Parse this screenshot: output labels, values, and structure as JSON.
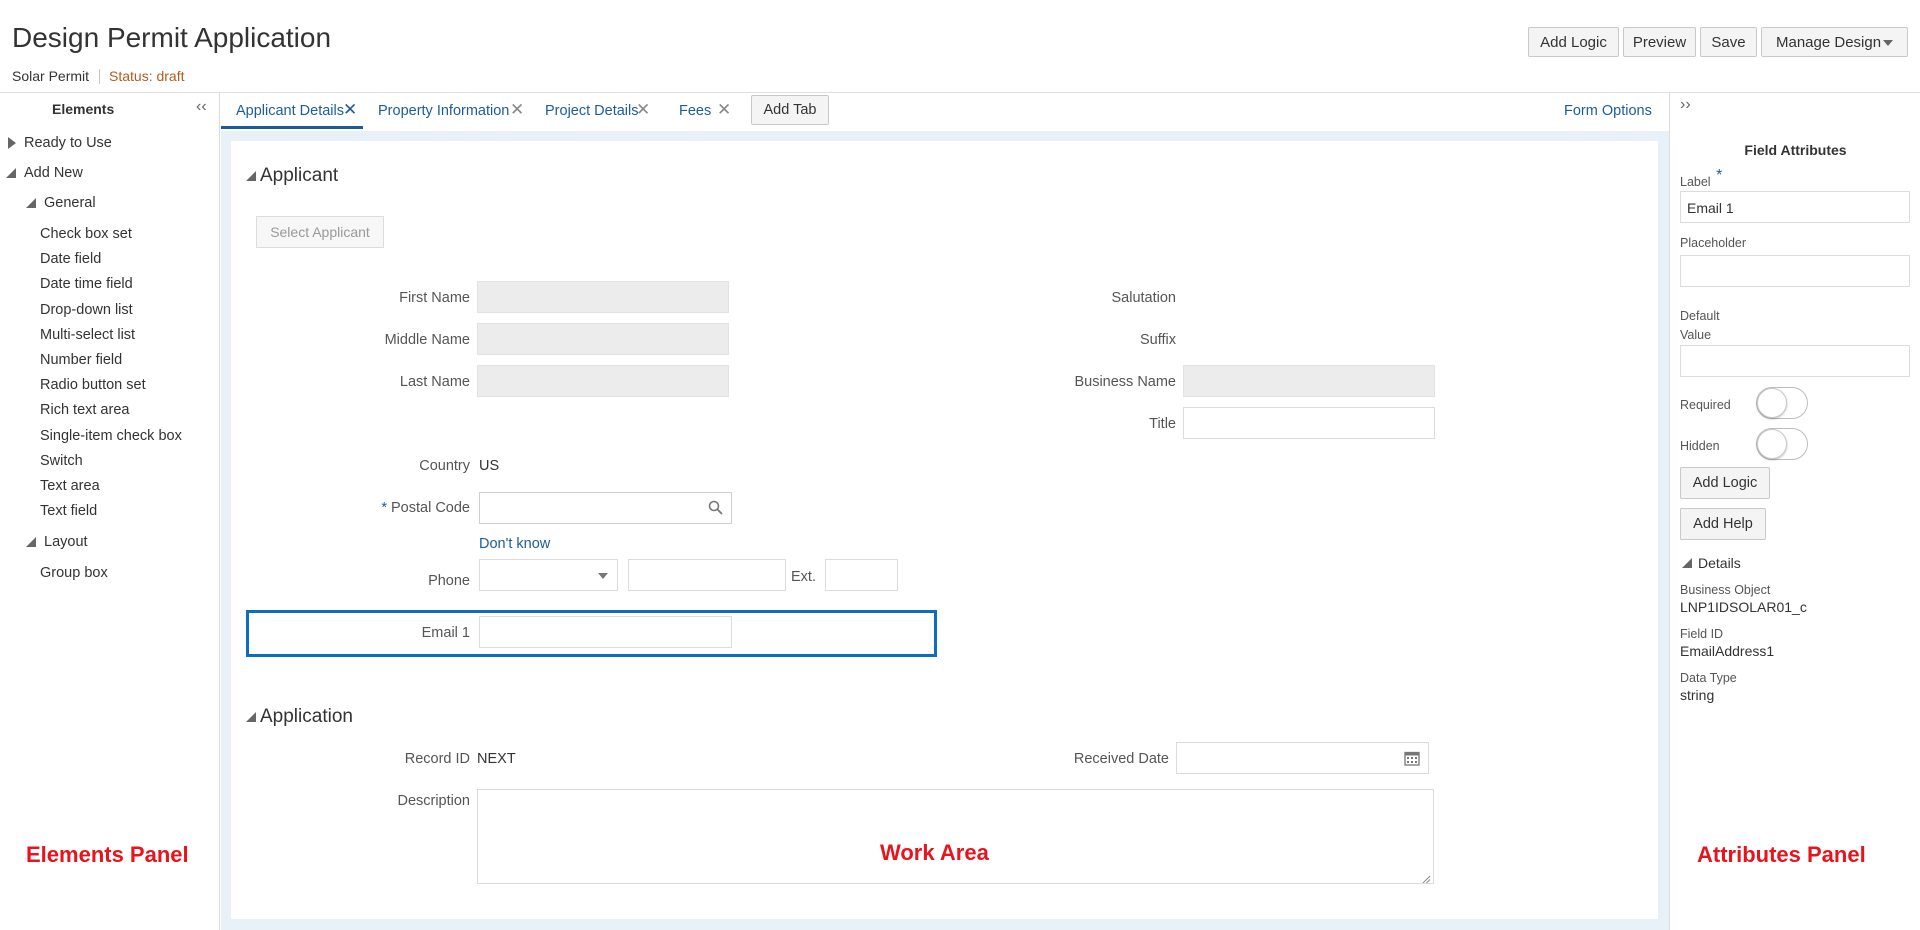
{
  "header": {
    "title": "Design Permit Application",
    "subtitle": "Solar Permit",
    "status": "Status: draft",
    "buttons": {
      "add_logic": "Add Logic",
      "preview": "Preview",
      "save": "Save",
      "manage_design": "Manage Design"
    }
  },
  "elements_panel": {
    "title": "Elements",
    "ready_to_use": "Ready to Use",
    "add_new": "Add New",
    "general": "General",
    "general_items": [
      "Check box set",
      "Date field",
      "Date time field",
      "Drop-down list",
      "Multi-select list",
      "Number field",
      "Radio button set",
      "Rich text area",
      "Single-item check box",
      "Switch",
      "Text area",
      "Text field"
    ],
    "layout": "Layout",
    "layout_items": [
      "Group box"
    ]
  },
  "tabs": {
    "items": [
      "Applicant Details",
      "Property Information",
      "Project Details",
      "Fees"
    ],
    "add_tab": "Add Tab",
    "form_options": "Form Options"
  },
  "applicant": {
    "section_title": "Applicant",
    "select_applicant": "Select Applicant",
    "first_name": "First Name",
    "middle_name": "Middle Name",
    "last_name": "Last Name",
    "salutation": "Salutation",
    "suffix": "Suffix",
    "business_name": "Business Name",
    "title": "Title",
    "country_label": "Country",
    "country_value": "US",
    "postal_code": "Postal Code",
    "required_mark": "*",
    "dont_know": "Don't know",
    "phone": "Phone",
    "ext": "Ext.",
    "email1": "Email 1"
  },
  "application": {
    "section_title": "Application",
    "record_id_label": "Record ID",
    "record_id_value": "NEXT",
    "received_date": "Received Date",
    "description": "Description"
  },
  "attributes_panel": {
    "title": "Field Attributes",
    "label": "Label",
    "required_mark": "*",
    "label_value": "Email 1",
    "placeholder": "Placeholder",
    "default_line1": "Default",
    "default_line2": "Value",
    "required": "Required",
    "hidden": "Hidden",
    "add_logic": "Add Logic",
    "add_help": "Add Help",
    "details": "Details",
    "business_object_label": "Business Object",
    "business_object_value": "LNP1IDSOLAR01_c",
    "field_id_label": "Field ID",
    "field_id_value": "EmailAddress1",
    "data_type_label": "Data Type",
    "data_type_value": "string"
  },
  "annotations": {
    "elements_panel": "Elements Panel",
    "work_area": "Work Area",
    "attributes_panel": "Attributes Panel"
  },
  "colors": {
    "link": "#1b5d9c",
    "status": "#b35c1e",
    "annotation": "#e8141c",
    "selection_border": "#0a6fc2"
  }
}
